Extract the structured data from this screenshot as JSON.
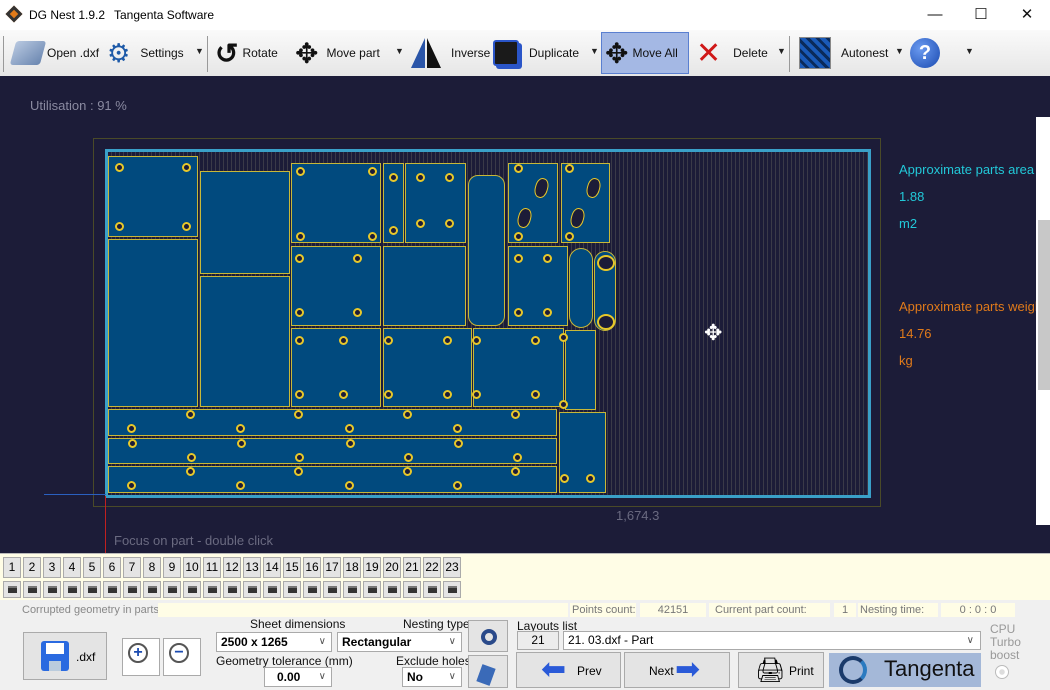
{
  "window": {
    "app_title": "DG Nest 1.9.2",
    "company": "Tangenta Software"
  },
  "toolbar": {
    "open": "Open .dxf",
    "settings": "Settings",
    "rotate": "Rotate",
    "move_part": "Move part",
    "inverse": "Inverse",
    "duplicate": "Duplicate",
    "move_all": "Move All",
    "delete": "Delete",
    "autonest": "Autonest"
  },
  "canvas": {
    "utilisation": "Utilisation : 91 %",
    "dimension_label": "1,674.3",
    "hint": "Focus on part - double click",
    "area_label": "Approximate parts area",
    "area_value": "1.88",
    "area_unit": "m2",
    "weight_label": "Approximate parts weight",
    "weight_value": "14.76",
    "weight_unit": "kg",
    "area_color": "#22c8d8",
    "weight_color": "#e07a1a"
  },
  "layout_tabs": [
    "1",
    "2",
    "3",
    "4",
    "5",
    "6",
    "7",
    "8",
    "9",
    "10",
    "11",
    "12",
    "13",
    "14",
    "15",
    "16",
    "17",
    "18",
    "19",
    "20",
    "21",
    "22",
    "23"
  ],
  "status": {
    "corrupted_label": "Corrupted geometry in parts:",
    "corrupted_value": "",
    "points_label": "Points count:",
    "points_value": "42151",
    "part_count_label": "Current part count:",
    "part_count_value": "1",
    "nesting_time_label": "Nesting time:",
    "nesting_time_value": "0 : 0 : 0"
  },
  "controls": {
    "save_dxf": ".dxf",
    "sheet_dim_label": "Sheet dimensions",
    "sheet_dim_value": "2500 x 1265",
    "nesting_type_label": "Nesting type",
    "nesting_type_value": "Rectangular",
    "tolerance_label": "Geometry tolerance (mm)",
    "tolerance_value": "0.00",
    "exclude_holes_label": "Exclude holes",
    "exclude_holes_value": "No",
    "layouts_label": "Layouts list",
    "layout_number": "21",
    "layout_value": "21. 03.dxf - Part",
    "prev": "Prev",
    "next": "Next",
    "print": "Print",
    "brand": "Tangenta",
    "cpu_turbo": "CPU Turbo boost"
  }
}
